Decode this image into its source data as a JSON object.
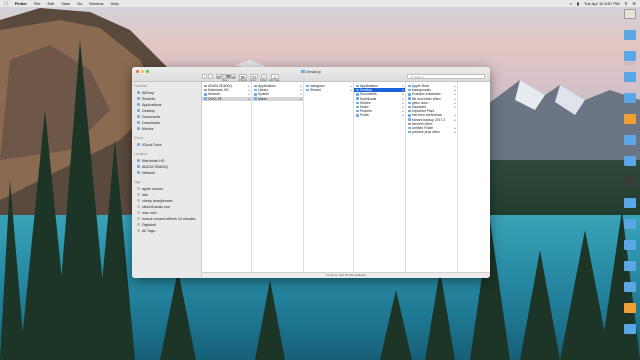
{
  "menubar": {
    "apple": "",
    "app": "Finder",
    "items": [
      "File",
      "Edit",
      "View",
      "Go",
      "Window",
      "Help"
    ],
    "clock": "Tue Apr 10 8:57 PM"
  },
  "desktop_icons": [
    {
      "label": "",
      "kind": "thumb"
    },
    {
      "label": "",
      "kind": "folder"
    },
    {
      "label": "Master",
      "kind": "folder"
    },
    {
      "label": "",
      "kind": "folder"
    },
    {
      "label": "",
      "kind": "folder"
    },
    {
      "label": "",
      "kind": "orange"
    },
    {
      "label": "",
      "kind": "folder"
    },
    {
      "label": "",
      "kind": "folder"
    },
    {
      "label": "",
      "kind": "dark"
    },
    {
      "label": "",
      "kind": "folder"
    },
    {
      "label": "",
      "kind": "folder"
    },
    {
      "label": "",
      "kind": "folder"
    },
    {
      "label": "",
      "kind": "folder"
    },
    {
      "label": "",
      "kind": "folder"
    },
    {
      "label": "",
      "kind": "orange"
    },
    {
      "label": "",
      "kind": "folder"
    }
  ],
  "window": {
    "title": "Desktop",
    "search_placeholder": "Search",
    "toolbar": {
      "view": "View",
      "arrange": "Arrange",
      "action": "Action",
      "share": "Share",
      "edit_tags": "Edit Tags"
    },
    "status": "11 items, 343.78 GB available"
  },
  "sidebar": {
    "sections": [
      {
        "title": "Favorites",
        "items": [
          "AirDrop",
          "Recents",
          "Applications",
          "Desktop",
          "Documents",
          "Downloads",
          "Movies"
        ]
      },
      {
        "title": "iCloud",
        "items": [
          "iCloud Drive"
        ]
      },
      {
        "title": "Locations",
        "items": [
          "Macintosh HD",
          "ADATA SD600Q",
          "Network"
        ]
      },
      {
        "title": "Tags",
        "items": [
          "apple rumors",
          "fast",
          "cheap headphones",
          "clicknill audio one",
          "mac mini",
          "macos unused effects 10 minutes",
          "Digitalnit",
          "All Tags..."
        ]
      }
    ]
  },
  "columns": [
    {
      "items": [
        {
          "name": "ADATA SD600Q",
          "kind": "disk",
          "chev": true
        },
        {
          "name": "Macintosh HD",
          "kind": "disk",
          "chev": true
        },
        {
          "name": "Network",
          "kind": "folder",
          "chev": true
        },
        {
          "name": "OSX1.75",
          "kind": "folder",
          "chev": true,
          "sel": "grey"
        }
      ]
    },
    {
      "items": [
        {
          "name": "Applications",
          "kind": "folder",
          "chev": true
        },
        {
          "name": "Library",
          "kind": "folder",
          "chev": true
        },
        {
          "name": "System",
          "kind": "folder",
          "chev": true
        },
        {
          "name": "Users",
          "kind": "folder",
          "chev": true,
          "sel": "grey"
        }
      ]
    },
    {
      "items": [
        {
          "name": "instagram",
          "kind": "folder",
          "chev": true
        },
        {
          "name": "Shared",
          "kind": "folder",
          "chev": true
        }
      ]
    },
    {
      "items": [
        {
          "name": "Applications",
          "kind": "folder",
          "chev": true
        },
        {
          "name": "Desktop",
          "kind": "folder",
          "chev": true,
          "sel": "blue"
        },
        {
          "name": "Documents",
          "kind": "folder",
          "chev": true
        },
        {
          "name": "Downloads",
          "kind": "folder",
          "chev": true
        },
        {
          "name": "Movies",
          "kind": "folder",
          "chev": true
        },
        {
          "name": "Music",
          "kind": "folder",
          "chev": true
        },
        {
          "name": "Pictures",
          "kind": "folder",
          "chev": true
        },
        {
          "name": "Public",
          "kind": "folder",
          "chev": true
        }
      ]
    },
    {
      "items": [
        {
          "name": "Apple Store",
          "kind": "folder",
          "chev": true
        },
        {
          "name": "backgrounds",
          "kind": "folder",
          "chev": true
        },
        {
          "name": "Example Automator",
          "kind": "folder",
          "chev": true
        },
        {
          "name": "file and folder video",
          "kind": "folder",
          "chev": true
        },
        {
          "name": "geico docs",
          "kind": "folder",
          "chev": true
        },
        {
          "name": "Important",
          "kind": "folder",
          "chev": true
        },
        {
          "name": "Important Plan!",
          "kind": "doc",
          "chev": false
        },
        {
          "name": "info from conference",
          "kind": "folder",
          "chev": true
        },
        {
          "name": "Movies backup 2017-2",
          "kind": "folder",
          "chev": true
        },
        {
          "name": "Nemeth Word",
          "kind": "doc",
          "chev": false
        },
        {
          "name": "Untitled Folder",
          "kind": "folder",
          "chev": true
        },
        {
          "name": "youtube pros video",
          "kind": "folder",
          "chev": true
        }
      ]
    }
  ]
}
